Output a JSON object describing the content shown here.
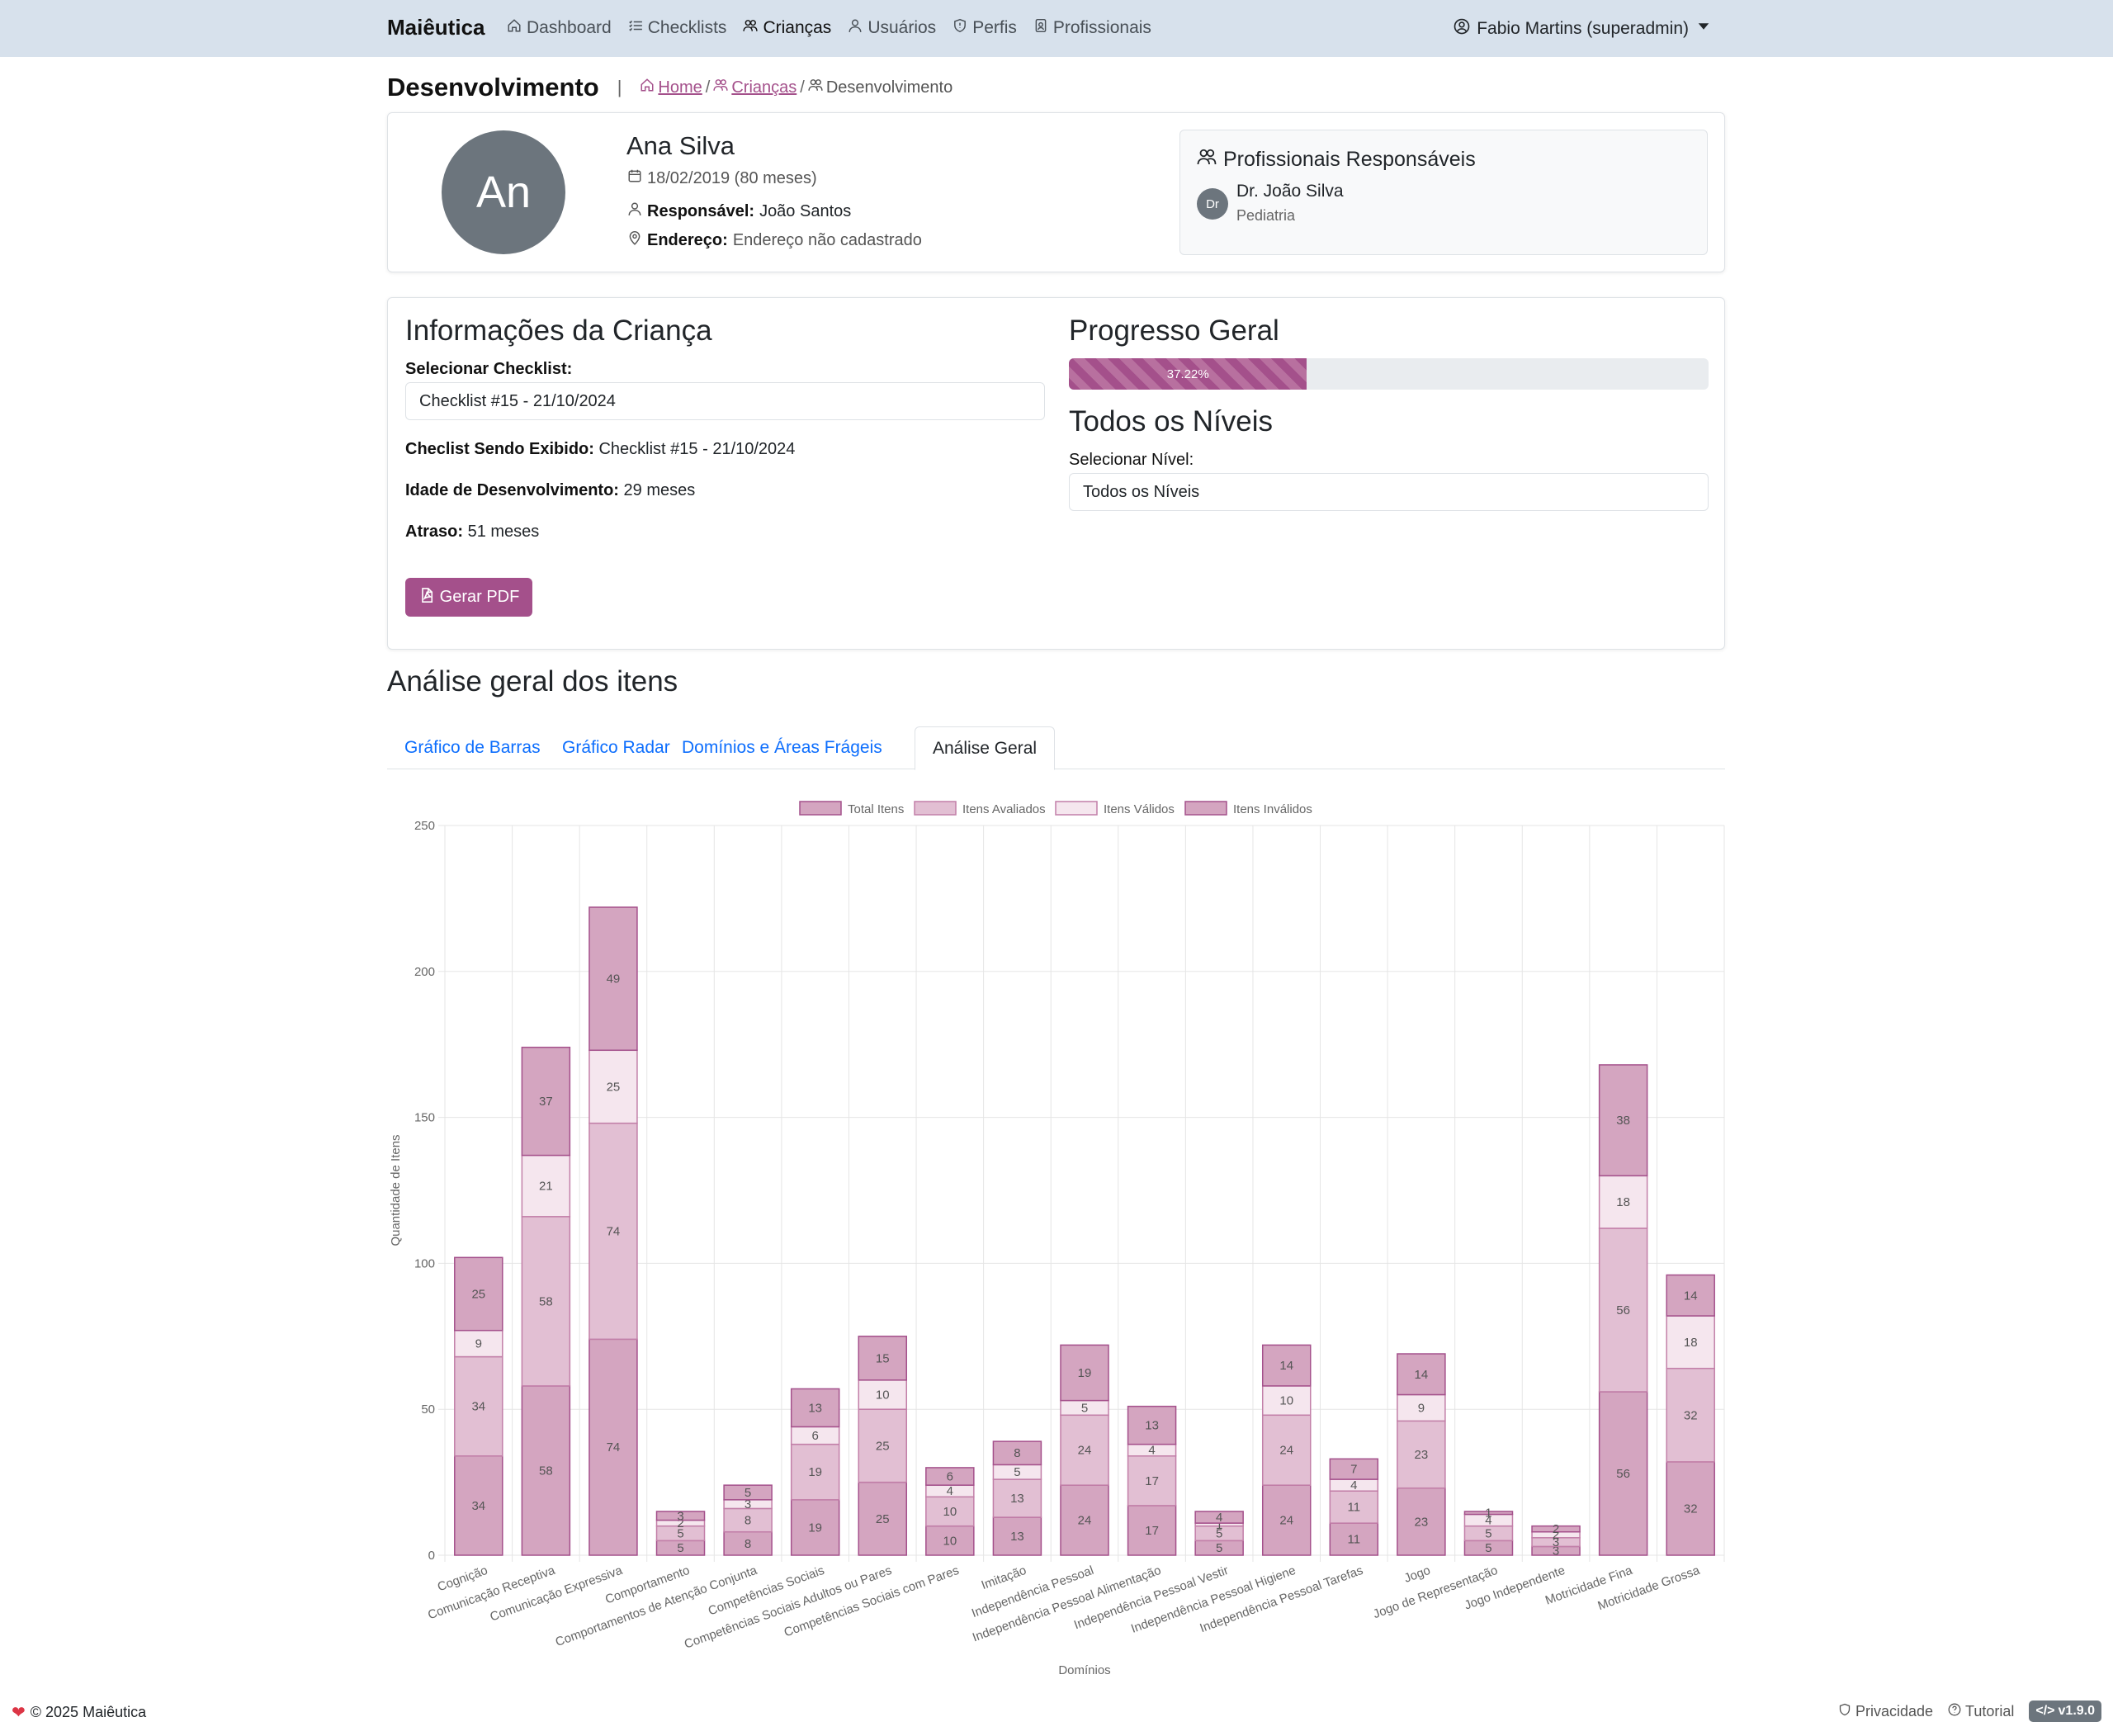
{
  "navbar": {
    "brand": "Maiêutica",
    "items": [
      {
        "label": "Dashboard",
        "icon": "house-icon"
      },
      {
        "label": "Checklists",
        "icon": "list-check-icon"
      },
      {
        "label": "Crianças",
        "icon": "people-icon"
      },
      {
        "label": "Usuários",
        "icon": "person-icon"
      },
      {
        "label": "Perfis",
        "icon": "shield-icon"
      },
      {
        "label": "Profissionais",
        "icon": "badge-icon"
      }
    ],
    "active": "Crianças",
    "user": "Fabio Martins (superadmin)"
  },
  "header": {
    "title": "Desenvolvimento",
    "breadcrumb": {
      "home": "Home",
      "children": "Crianças",
      "current": "Desenvolvimento"
    }
  },
  "child": {
    "initials": "An",
    "name": "Ana Silva",
    "birth": "18/02/2019 (80 meses)",
    "responsible_label": "Responsável:",
    "responsible": "João Santos",
    "address_label": "Endereço:",
    "address": "Endereço não cadastrado"
  },
  "professionals": {
    "title": "Profissionais Responsáveis",
    "items": [
      {
        "initials": "Dr",
        "name": "Dr. João Silva",
        "specialty": "Pediatria"
      }
    ]
  },
  "info": {
    "title": "Informações da Criança",
    "checklist_label": "Selecionar Checklist:",
    "checklist_value": "Checklist #15 - 21/10/2024",
    "showing_label": "Checlist Sendo Exibido:",
    "showing_value": "Checklist #15 - 21/10/2024",
    "dev_age_label": "Idade de Desenvolvimento:",
    "dev_age_value": "29 meses",
    "delay_label": "Atraso:",
    "delay_value": "51 meses",
    "pdf_button": "Gerar PDF"
  },
  "progress": {
    "title": "Progresso Geral",
    "percent": 37.22,
    "label": "37.22%",
    "levels_title": "Todos os Níveis",
    "level_label": "Selecionar Nível:",
    "level_value": "Todos os Níveis"
  },
  "analysis": {
    "title": "Análise geral dos itens",
    "tabs": [
      "Gráfico de Barras",
      "Gráfico Radar",
      "Domínios e Áreas Frágeis",
      "Análise Geral"
    ],
    "active_tab": 3
  },
  "colors": {
    "accent": "#a4508b",
    "total": "#d4a5c0",
    "avaliados": "#e2bfd3",
    "validos": "#f5e6ee",
    "invalidos": "#d4a5c0",
    "nav_bg": "#d7e1ec"
  },
  "chart_data": {
    "type": "bar",
    "stacked": true,
    "xlabel": "Domínios",
    "ylabel": "Quantidade de Itens",
    "ylim": [
      0,
      250
    ],
    "yticks": [
      0,
      50,
      100,
      150,
      200,
      250
    ],
    "legend_position": "top",
    "grid": true,
    "categories": [
      "Cognição",
      "Comunicação Receptiva",
      "Comunicação Expressiva",
      "Comportamento",
      "Comportamentos de Atenção Conjunta",
      "Competências Sociais",
      "Competências Sociais Adultos ou Pares",
      "Competências Sociais com Pares",
      "Imitação",
      "Independência Pessoal",
      "Independência Pessoal Alimentação",
      "Independência Pessoal Vestir",
      "Independência Pessoal Higiene",
      "Independência Pessoal Tarefas",
      "Jogo",
      "Jogo de Representação",
      "Jogo Independente",
      "Motricidade Fina",
      "Motricidade Grossa"
    ],
    "series": [
      {
        "name": "Total Itens",
        "values": [
          34,
          58,
          74,
          5,
          8,
          19,
          25,
          10,
          13,
          24,
          17,
          5,
          24,
          11,
          23,
          5,
          3,
          56,
          32
        ]
      },
      {
        "name": "Itens Avaliados",
        "values": [
          34,
          58,
          74,
          5,
          8,
          19,
          25,
          10,
          13,
          24,
          17,
          5,
          24,
          11,
          23,
          5,
          3,
          56,
          32
        ]
      },
      {
        "name": "Itens Válidos",
        "values": [
          9,
          21,
          25,
          2,
          3,
          6,
          10,
          4,
          5,
          5,
          4,
          1,
          10,
          4,
          9,
          4,
          2,
          18,
          18
        ]
      },
      {
        "name": "Itens Inválidos",
        "values": [
          25,
          37,
          49,
          3,
          5,
          13,
          15,
          6,
          8,
          19,
          13,
          4,
          14,
          7,
          14,
          1,
          2,
          38,
          14
        ]
      }
    ]
  },
  "footer": {
    "copyright": "© 2025 Maiêutica",
    "privacy": "Privacidade",
    "tutorial": "Tutorial",
    "version": "v1.9.0"
  }
}
